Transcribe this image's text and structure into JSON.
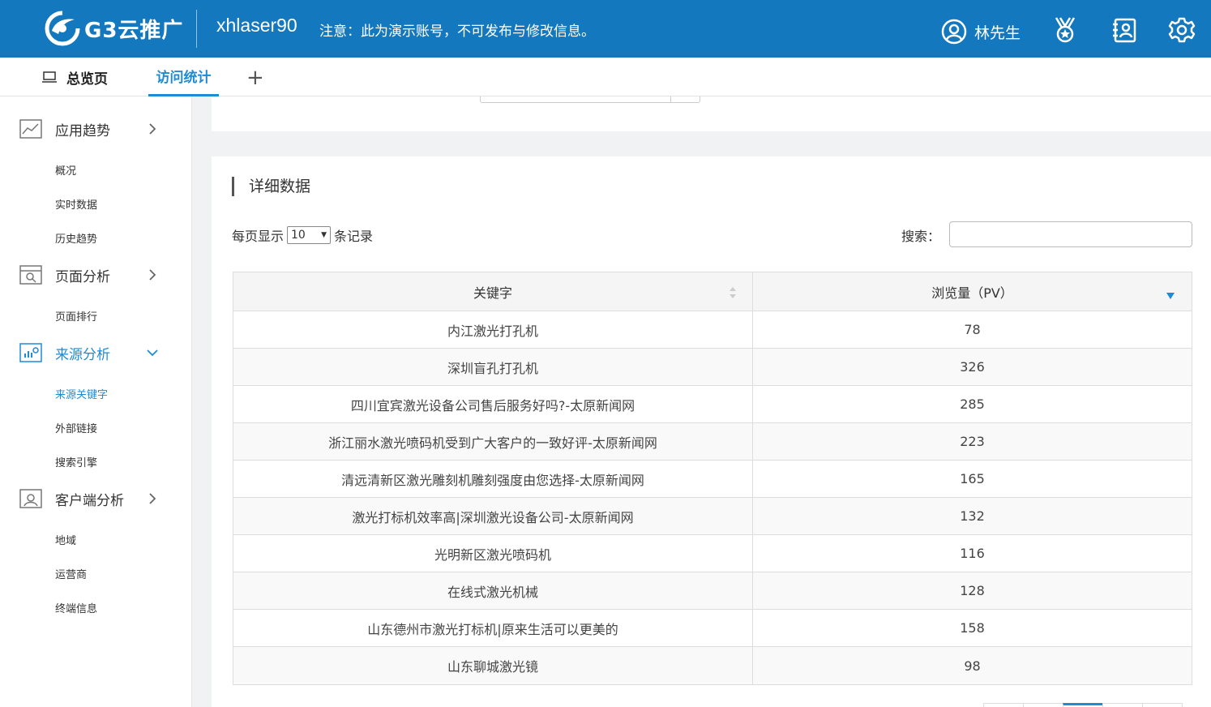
{
  "header": {
    "logo_text": "G3云推广",
    "account": "xhlaser90",
    "notice": "注意：此为演示账号，不可发布与修改信息。",
    "user_name": "林先生",
    "icons": [
      "user-icon",
      "medal-icon",
      "contacts-icon",
      "gear-icon"
    ],
    "bg_color": "#1478be"
  },
  "tabs": [
    {
      "label": "总览页",
      "icon": "monitor-icon",
      "active": false
    },
    {
      "label": "访问统计",
      "active": true
    }
  ],
  "sidebar": {
    "groups": [
      {
        "label": "应用趋势",
        "icon": "trend-icon",
        "expanded": false,
        "items": [
          "概况",
          "实时数据",
          "历史趋势"
        ]
      },
      {
        "label": "页面分析",
        "icon": "page-search-icon",
        "expanded": false,
        "items": [
          "页面排行"
        ]
      },
      {
        "label": "来源分析",
        "icon": "source-chart-icon",
        "expanded": true,
        "active": true,
        "items": [
          "来源关键字",
          "外部链接",
          "搜索引擎"
        ]
      },
      {
        "label": "客户端分析",
        "icon": "client-icon",
        "expanded": false,
        "items": [
          "地域",
          "运营商",
          "终端信息"
        ]
      }
    ],
    "active_item": "来源关键字"
  },
  "main": {
    "section_title": "详细数据",
    "perpage_prefix": "每页显示",
    "perpage_value": "10",
    "perpage_suffix": "条记录",
    "search_label": "搜索：",
    "search_value": "",
    "table": {
      "columns": [
        "关键字",
        "浏览量（PV）"
      ],
      "rows": [
        {
          "keyword": "内江激光打孔机",
          "pv": "78"
        },
        {
          "keyword": "深圳盲孔打孔机",
          "pv": "326"
        },
        {
          "keyword": "四川宜宾激光设备公司售后服务好吗?-太原新闻网",
          "pv": "285"
        },
        {
          "keyword": "浙江丽水激光喷码机受到广大客户的一致好评-太原新闻网",
          "pv": "223"
        },
        {
          "keyword": "清远清新区激光雕刻机雕刻强度由您选择-太原新闻网",
          "pv": "165"
        },
        {
          "keyword": "激光打标机效率高|深圳激光设备公司-太原新闻网",
          "pv": "132"
        },
        {
          "keyword": "光明新区激光喷码机",
          "pv": "116"
        },
        {
          "keyword": "在线式激光机械",
          "pv": "128"
        },
        {
          "keyword": "山东德州市激光打标机|原来生活可以更美的",
          "pv": "158"
        },
        {
          "keyword": "山东聊城激光镜",
          "pv": "98"
        }
      ]
    },
    "accent_color": "#1e8bd4"
  }
}
